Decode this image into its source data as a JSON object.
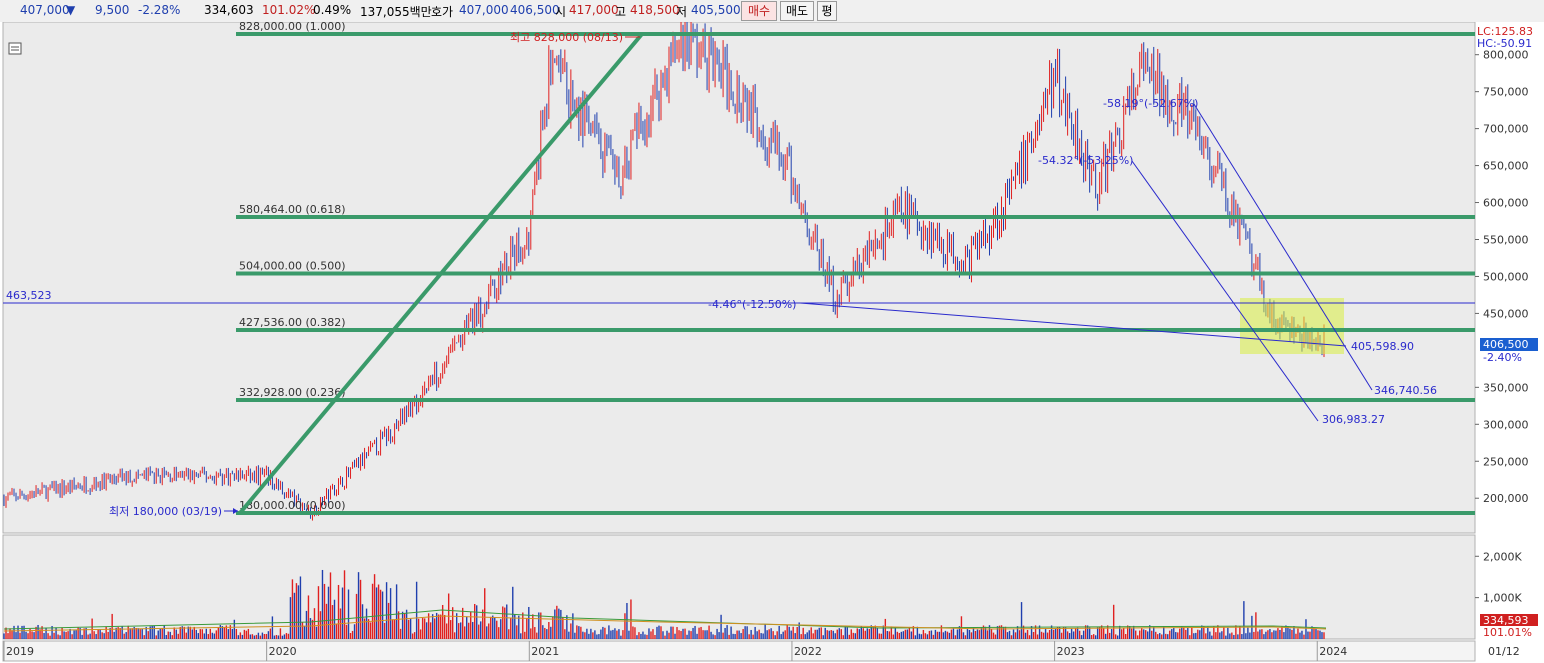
{
  "quote": {
    "price": "407,000",
    "change": "9,500",
    "change_pct": "-2.28%",
    "volume": "334,603",
    "vol_ratio": "101.02%",
    "turnover_pct": "0.49%",
    "amount": "137,055백만",
    "ask_label": "호가",
    "ask": "407,000",
    "bid": "406,500",
    "open_label": "시",
    "open": "417,000",
    "high_label": "고",
    "high": "418,500",
    "low_label": "저",
    "low": "405,500"
  },
  "buttons": {
    "buy": "매수",
    "sell": "매도",
    "avg": "평"
  },
  "price_axis": {
    "labels": [
      "800,000",
      "750,000",
      "700,000",
      "650,000",
      "600,000",
      "550,000",
      "500,000",
      "450,000",
      "350,000",
      "300,000",
      "250,000",
      "200,000"
    ],
    "lc": "LC:125.83",
    "hc": "HC:-50.91",
    "current": "406,500",
    "current_pct": "-2.40%"
  },
  "volume_axis": {
    "labels": [
      "2,000K",
      "1,000K"
    ],
    "current": "334,593",
    "current_pct": "101.01%"
  },
  "time_axis": [
    "2019",
    "2020",
    "2021",
    "2022",
    "2023",
    "2024",
    "01/12"
  ],
  "fib_levels": [
    {
      "label": "828,000.00 (1.000)",
      "value": 828000
    },
    {
      "label": "580,464.00 (0.618)",
      "value": 580464
    },
    {
      "label": "504,000.00 (0.500)",
      "value": 504000
    },
    {
      "label": "427,536.00 (0.382)",
      "value": 427536
    },
    {
      "label": "332,928.00 (0.236)",
      "value": 332928
    },
    {
      "label": "180,000.00 (0.000)",
      "value": 180000
    }
  ],
  "annotations": {
    "hline": "463,523",
    "high_marker": "최고 828,000 (08/13)",
    "low_marker": "최저 180,000 (03/19)",
    "angle1": "-4.46°(-12.50%)",
    "angle2": "-54.32°(-53.25%)",
    "angle3": "-58.19°(-52.67%)",
    "target1": "405,598.90",
    "target2": "346,740.56",
    "target3": "306,983.27"
  },
  "colors": {
    "fib": "#3a9a6a",
    "up": "#e02020",
    "down": "#1f3fae",
    "channel": "#2a2acc",
    "highlight": "#d8ee40",
    "price_box": "#1a5fd0",
    "vol_box": "#d02020"
  },
  "chart_data": {
    "type": "line",
    "title": "",
    "xlabel": "",
    "ylabel": "",
    "ylim": [
      165000,
      838000
    ],
    "x": [
      "2019-01",
      "2019-07",
      "2020-01",
      "2020-03",
      "2020-07",
      "2020-10",
      "2021-01",
      "2021-02",
      "2021-05",
      "2021-08",
      "2021-11",
      "2022-01",
      "2022-03",
      "2022-06",
      "2022-09",
      "2022-11",
      "2023-01",
      "2023-03",
      "2023-05",
      "2023-07",
      "2023-09",
      "2023-11",
      "2024-01"
    ],
    "series": [
      {
        "values": [
          200000,
          230000,
          230000,
          180000,
          300000,
          420000,
          560000,
          790000,
          630000,
          828000,
          740000,
          630000,
          470000,
          590000,
          520000,
          610000,
          770000,
          620000,
          780000,
          720000,
          600000,
          440000,
          407000
        ]
      }
    ]
  }
}
